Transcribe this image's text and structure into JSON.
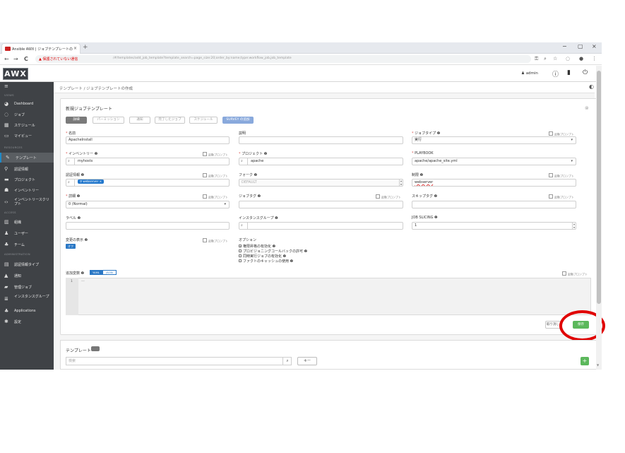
{
  "browser": {
    "tab_title": "Ansible AWX | ジョブテンプレートの",
    "tab_close": "×",
    "new_tab": "+",
    "win_min": "−",
    "win_max": "▢",
    "win_close": "×",
    "back": "←",
    "forward": "→",
    "reload": "C",
    "security_warning": "▲ 保護されていない通信",
    "url": "/#/templates/add_job_template?template_search=page_size:20;order_by:name;type:workflow_job,job_template",
    "icons": [
      "key-icon",
      "zoom-icon",
      "star-icon",
      "extension-icon",
      "profile-icon",
      "menu-icon"
    ]
  },
  "header": {
    "logo": "AWX",
    "user": "admin",
    "icons": [
      "user-icon",
      "info-icon",
      "docs-icon",
      "logout-icon"
    ]
  },
  "sidebar": {
    "menu_icon": "≡",
    "sections": {
      "views": "VIEWS",
      "resources": "RESOURCES",
      "access": "ACCESS",
      "administration": "ADMINISTRATION"
    },
    "items": [
      {
        "label": "Dashboard",
        "icon": "dashboard-icon"
      },
      {
        "label": "ジョブ",
        "icon": "jobs-icon"
      },
      {
        "label": "スケジュール",
        "icon": "calendar-icon"
      },
      {
        "label": "マイビュー",
        "icon": "myview-icon"
      },
      {
        "label": "テンプレート",
        "icon": "template-icon"
      },
      {
        "label": "認証情報",
        "icon": "key-icon"
      },
      {
        "label": "プロジェクト",
        "icon": "folder-icon"
      },
      {
        "label": "インベントリー",
        "icon": "inventory-icon"
      },
      {
        "label": "インベントリースクリプト",
        "icon": "script-icon"
      },
      {
        "label": "組織",
        "icon": "building-icon"
      },
      {
        "label": "ユーザー",
        "icon": "user-icon"
      },
      {
        "label": "チーム",
        "icon": "team-icon"
      },
      {
        "label": "認証情報タイプ",
        "icon": "credential-type-icon"
      },
      {
        "label": "通知",
        "icon": "bell-icon"
      },
      {
        "label": "管理ジョブ",
        "icon": "briefcase-icon"
      },
      {
        "label": "インスタンスグループ",
        "icon": "server-icon"
      },
      {
        "label": "Applications",
        "icon": "applications-icon"
      },
      {
        "label": "設定",
        "icon": "gear-icon"
      }
    ]
  },
  "breadcrumb": "テンプレート / ジョブテンプレートの作成",
  "form": {
    "title": "新規ジョブテンプレート",
    "tabs": [
      "詳細",
      "パーミッション",
      "通知",
      "完了したジョブ",
      "スケジュール",
      "SURVEY の追加"
    ],
    "prompt_text": "起動プロンプト",
    "name": {
      "label": "名前",
      "value": "ApacheInstall"
    },
    "description": {
      "label": "説明",
      "value": ""
    },
    "job_type": {
      "label": "ジョブタイプ",
      "value": "実行"
    },
    "inventory": {
      "label": "インベントリー",
      "value": "myhosts"
    },
    "project": {
      "label": "プロジェクト",
      "value": "apache"
    },
    "playbook": {
      "label": "PLAYBOOK",
      "value": "apache/apache_site.yml"
    },
    "credentials": {
      "label": "認証情報",
      "chip": "webserver"
    },
    "forks": {
      "label": "フォーク",
      "value": "DEFAULT"
    },
    "limit": {
      "label": "制限",
      "value": "webserver"
    },
    "verbosity": {
      "label": "詳細",
      "value": "0 (Normal)"
    },
    "job_tags": {
      "label": "ジョブタグ",
      "value": ""
    },
    "skip_tags": {
      "label": "スキップタグ",
      "value": ""
    },
    "labels": {
      "label": "ラベル",
      "value": ""
    },
    "instance_groups": {
      "label": "インスタンスグループ",
      "value": ""
    },
    "job_slicing": {
      "label": "JOB SLICING",
      "value": "1"
    },
    "show_changes": {
      "label": "変更の表示",
      "toggle": "オフ"
    },
    "options": {
      "label": "オプション",
      "items": [
        {
          "label": "権限昇格の有効化",
          "checked": true
        },
        {
          "label": "プロビジョニングコールバックの許可",
          "checked": false
        },
        {
          "label": "同時実行ジョブの有効化",
          "checked": false
        },
        {
          "label": "ファクトのキャッシュの使用",
          "checked": false
        }
      ]
    },
    "extra_vars": {
      "label": "追加変数",
      "yaml": "YAML",
      "json": "JSON",
      "line_no": "1",
      "content": "---"
    },
    "cancel": "取り消し",
    "save": "保存"
  },
  "templates_panel": {
    "title": "テンプレート",
    "count": "",
    "search_placeholder": "検索",
    "key_button": "キー",
    "add_button": "+"
  }
}
